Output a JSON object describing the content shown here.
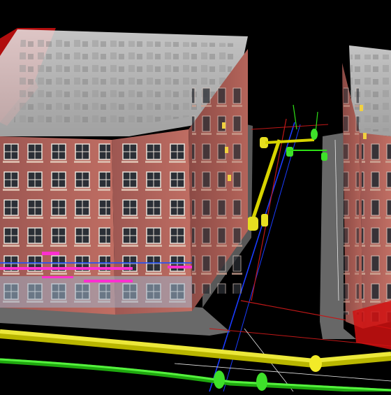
{
  "viewport": {
    "background": "#000000",
    "kind": "3d-bim-model-view"
  },
  "scene": {
    "buildings": [
      {
        "name": "building-left",
        "brick_color": "#b7665c",
        "glass_roof_color": "#cfcfcf",
        "floors": 6
      },
      {
        "name": "building-right",
        "brick_color": "#b7665c",
        "glass_roof_color": "#cfcfcf",
        "floors": 6
      }
    ],
    "clash_zone_color": "#d01010",
    "utilities": [
      {
        "name": "storm-pipe-yellow",
        "color": "#e6e000"
      },
      {
        "name": "water-pipe-green",
        "color": "#2ee016"
      },
      {
        "name": "sewer-line-blue",
        "color": "#1a3cff"
      },
      {
        "name": "electric-line-red",
        "color": "#c01818"
      },
      {
        "name": "gas-line-white",
        "color": "#e8e8e8"
      }
    ],
    "highlight_color": "#ff2fd0"
  }
}
